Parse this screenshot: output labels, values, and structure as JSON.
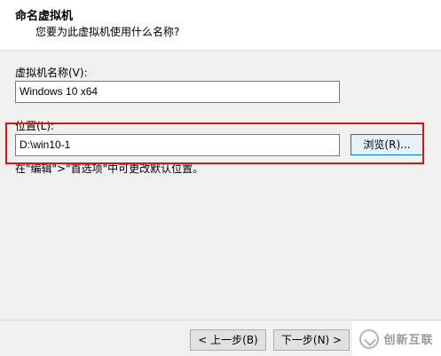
{
  "header": {
    "title": "命名虚拟机",
    "subtitle": "您要为此虚拟机使用什么名称?"
  },
  "vm_name": {
    "label": "虚拟机名称(V):",
    "value": "Windows 10 x64"
  },
  "location": {
    "label": "位置(L):",
    "value": "D:\\win10-1",
    "browse_label": "浏览(R)...",
    "hint": "在\"编辑\">\"首选项\"中可更改默认位置。"
  },
  "footer": {
    "back_label": "< 上一步(B)",
    "next_label": "下一步(N) >"
  },
  "watermark": {
    "text": "创新互联"
  },
  "colors": {
    "highlight": "#e01010",
    "focus": "#0078d7"
  }
}
